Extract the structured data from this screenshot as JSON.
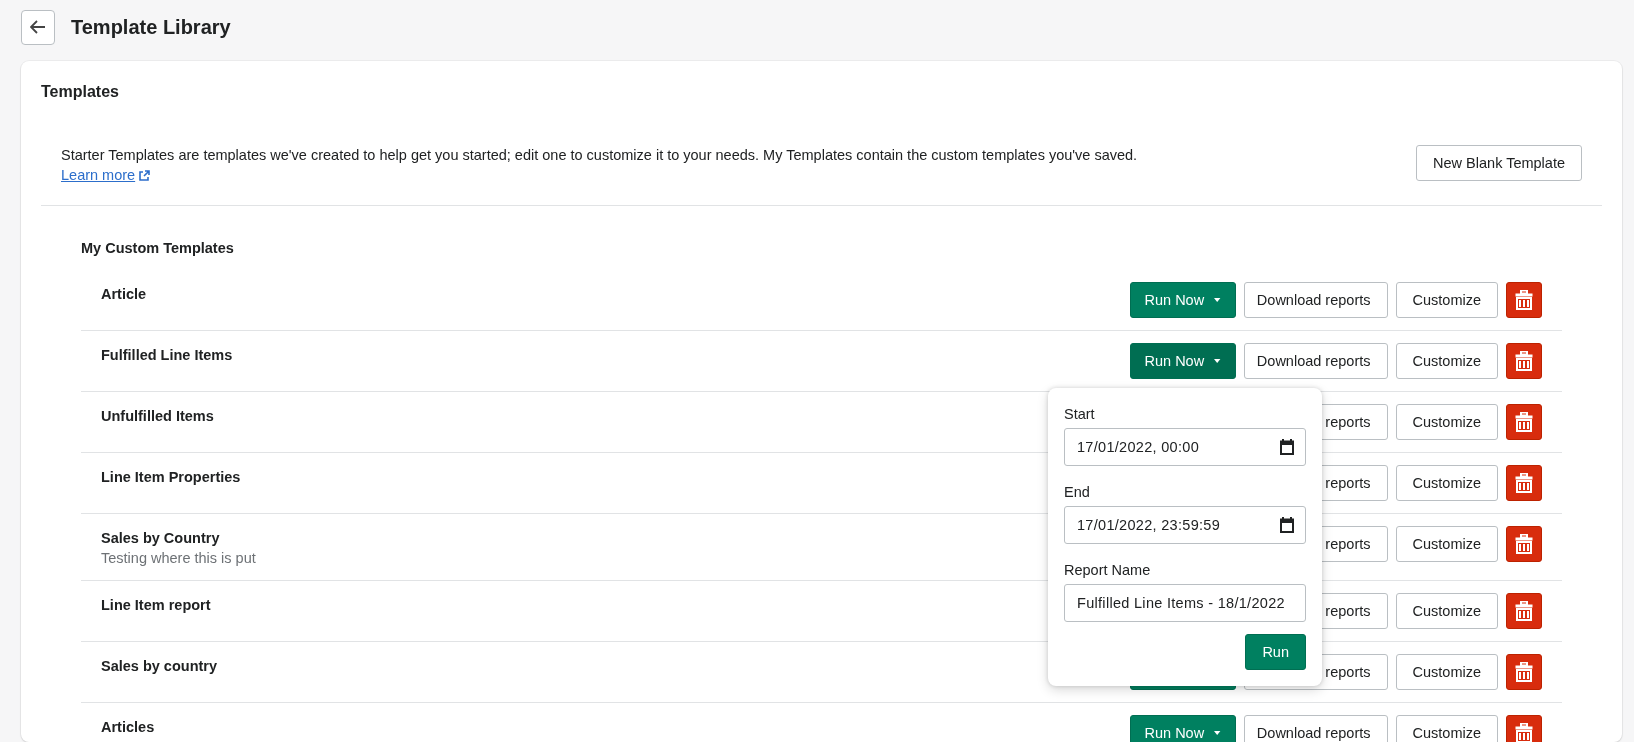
{
  "header": {
    "title": "Template Library"
  },
  "card": {
    "title": "Templates",
    "description": "Starter Templates are templates we've created to help get you started; edit one to customize it to your needs. My Templates contain the custom templates you've saved.",
    "learn_more": "Learn more",
    "new_button": "New Blank Template"
  },
  "section": {
    "title": "My Custom Templates",
    "rows": [
      {
        "name": "Article",
        "run": {
          "label": "Run Now"
        },
        "download": "Download reports",
        "customize": "Customize"
      },
      {
        "name": "Fulfilled Line Items",
        "run": {
          "label": "Run Now"
        },
        "download": "Download reports",
        "customize": "Customize",
        "expanded": true
      },
      {
        "name": "Unfulfilled Items",
        "download": "reports",
        "customize": "Customize"
      },
      {
        "name": "Line Item Properties",
        "download": "reports",
        "customize": "Customize"
      },
      {
        "name": "Sales by Country",
        "subtitle": "Testing where this is put",
        "download": "reports",
        "customize": "Customize"
      },
      {
        "name": "Line Item report",
        "download": "reports",
        "customize": "Customize"
      },
      {
        "name": "Sales by country",
        "run": {},
        "download": "reports",
        "customize": "Customize"
      },
      {
        "name": "Articles",
        "run": {
          "label": "Run Now"
        },
        "download": "Download reports",
        "customize": "Customize"
      }
    ]
  },
  "popover": {
    "fields": [
      {
        "label": "Start",
        "value": "17/01/2022, 00:00",
        "kind": "datetime"
      },
      {
        "label": "End",
        "value": "17/01/2022, 23:59:59",
        "kind": "datetime"
      },
      {
        "label": "Report Name",
        "value": "Fulfilled Line Items - 18/1/2022",
        "kind": "text"
      }
    ],
    "run_button": "Run"
  }
}
